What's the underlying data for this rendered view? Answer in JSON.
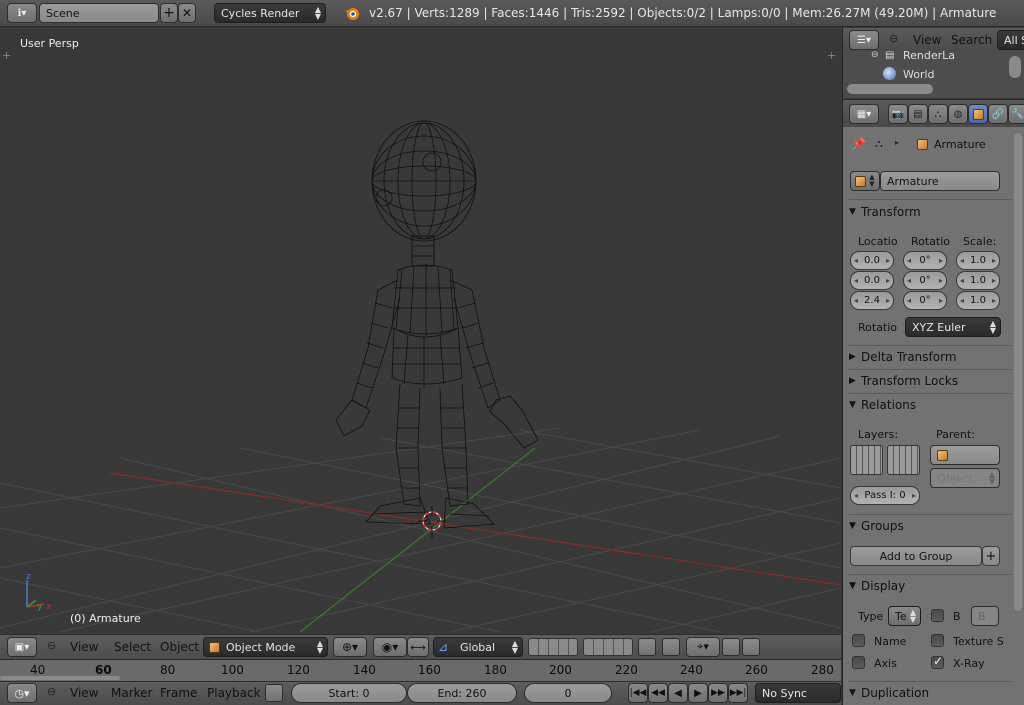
{
  "topbar": {
    "scene_name": "Scene",
    "render_engine": "Cycles Render",
    "info": "v2.67 | Verts:1289 | Faces:1446 | Tris:2592 | Objects:0/2 | Lamps:0/0 | Mem:26.27M (49.20M) | Armature"
  },
  "viewport": {
    "label": "User Persp",
    "object_label": "(0) Armature",
    "axis_x": "x",
    "axis_y": "y",
    "axis_z": "z"
  },
  "view3d_header": {
    "menus": [
      "View",
      "Select",
      "Object"
    ],
    "mode": "Object Mode",
    "orientation": "Global"
  },
  "timeline": {
    "ticks": [
      "40",
      "60",
      "80",
      "100",
      "120",
      "140",
      "160",
      "180",
      "200",
      "220",
      "240",
      "260",
      "280"
    ],
    "current_frame_marker": 60
  },
  "timeline_header": {
    "menus": [
      "View",
      "Marker",
      "Frame",
      "Playback"
    ],
    "start": "Start: 0",
    "end": "End: 260",
    "current": "0",
    "sync": "No Sync"
  },
  "outliner": {
    "menus": [
      "View",
      "Search"
    ],
    "filter": "All S",
    "items": [
      "RenderLa",
      "World"
    ]
  },
  "properties": {
    "breadcrumb": "Armature",
    "object_name": "Armature",
    "panels": {
      "transform": "Transform",
      "delta_transform": "Delta Transform",
      "transform_locks": "Transform Locks",
      "relations": "Relations",
      "groups": "Groups",
      "display": "Display",
      "duplication": "Duplication"
    },
    "transform": {
      "location_label": "Locatio",
      "rotation_label": "Rotatio",
      "scale_label": "Scale:",
      "location": [
        "0.0",
        "0.0",
        "2.4"
      ],
      "rotation": [
        "0°",
        "0°",
        "0°"
      ],
      "scale": [
        "1.0",
        "1.0",
        "1.0"
      ],
      "rotation_mode_label": "Rotatio",
      "rotation_mode": "XYZ Euler"
    },
    "relations": {
      "layers_label": "Layers:",
      "parent_label": "Parent:",
      "parent_type": "Object",
      "pass_index": "Pass I: 0"
    },
    "groups": {
      "add_button": "Add to Group"
    },
    "display": {
      "type_label": "Type",
      "type_value": "Te",
      "bounds_label": "B",
      "bounds_value": "B",
      "name_label": "Name",
      "texture_space_label": "Texture S",
      "axis_label": "Axis",
      "xray_label": "X-Ray",
      "xray_checked": true
    }
  }
}
